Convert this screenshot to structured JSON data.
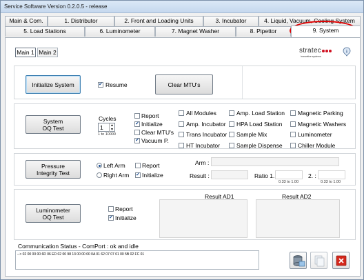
{
  "window": {
    "title": "Service Software Version 0.2.0.5 - release"
  },
  "tabs_row1": [
    "Main & Com.",
    "1. Distributor",
    "2. Front and Loading Units",
    "3. Incubator",
    "4. Liquid, Vacuum, Cooling System"
  ],
  "tabs_row2": [
    "5. Load Stations",
    "6. Luminometer",
    "7. Magnet Washer",
    "8. Pipettor",
    "9. System"
  ],
  "subtabs": [
    "Main 1",
    "Main 2"
  ],
  "brand": {
    "name": "stratec",
    "tagline": "innovative systems",
    "info_icon": "info-icon",
    "dots_color": "#d01020"
  },
  "init": {
    "button": "Initialize System",
    "resume": "Resume",
    "clear_button": "Clear MTU's"
  },
  "oq": {
    "button": "System\nOQ Test",
    "cycles_label": "Cycles",
    "cycles_value": "1",
    "cycles_range": "1 to 10000",
    "options": [
      {
        "label": "Report",
        "checked": false
      },
      {
        "label": "Initialize",
        "checked": true
      },
      {
        "label": "Clear MTU's",
        "checked": false
      },
      {
        "label": "Vacuum P.",
        "checked": true
      }
    ],
    "modules_col1": [
      "All Modules",
      "Amp. Incubator",
      "Trans Incubator",
      "HT Incubator"
    ],
    "modules_col2": [
      "Amp. Load Station",
      "HPA Load Station",
      "Sample Mix",
      "Sample Dispense"
    ],
    "modules_col3": [
      "Magnetic Parking",
      "Magnetic Washers",
      "Luminometer",
      "Chiller Module"
    ]
  },
  "pressure": {
    "button": "Pressure\nIntegrity Test",
    "left_arm": "Left Arm",
    "right_arm": "Right Arm",
    "report": "Report",
    "initialize": "Initialize",
    "arm_label": "Arm :",
    "result_label": "Result :",
    "ratio1_label": "Ratio 1. :",
    "ratio2_label": "2. :",
    "range1": "0.33 to 1.00",
    "range2": "0.33 to 1.00"
  },
  "luminometer": {
    "button": "Luminometer\nOQ Test",
    "report": "Report",
    "initialize": "Initialize",
    "result_ad1": "Result AD1",
    "result_ad2": "Result AD2"
  },
  "status": {
    "label": "Communication Status - ComPort : ok and idle",
    "log": "--> 02 00 00 00 6D 06 ED 02 00 98 13 00 00 00 0A 01 62 07 07 01 00 5B 02 FC 01"
  },
  "footer_icons": [
    "database-icon",
    "copy-icon",
    "close-icon"
  ],
  "colors": {
    "close_red": "#d4281c",
    "highlight_red": "#e00000"
  }
}
